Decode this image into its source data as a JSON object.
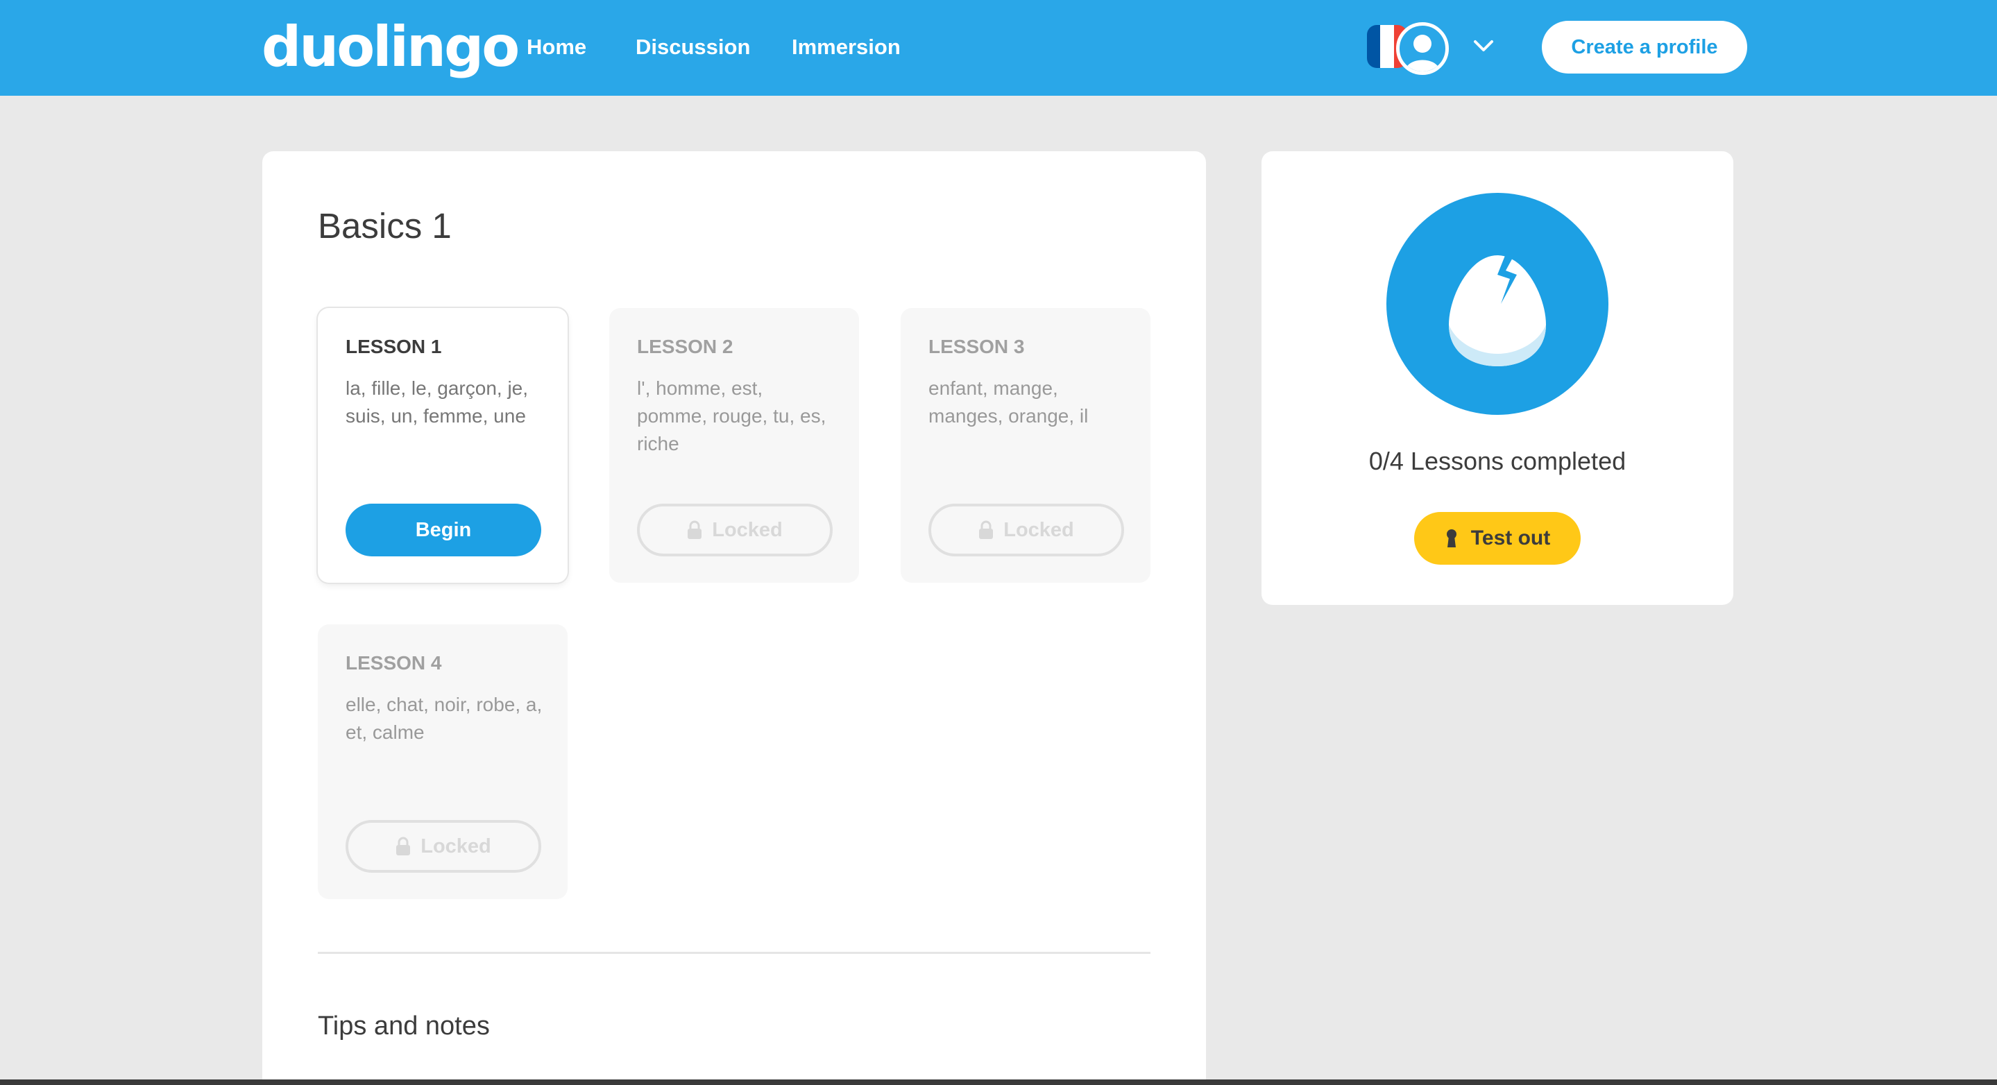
{
  "header": {
    "logo": "duolingo",
    "nav": [
      {
        "label": "Home"
      },
      {
        "label": "Discussion"
      },
      {
        "label": "Immersion"
      }
    ],
    "flag_colors": [
      "#0055a4",
      "#ffffff",
      "#ef4135"
    ],
    "create_profile_label": "Create a profile"
  },
  "skill": {
    "title": "Basics 1",
    "lessons": [
      {
        "title": "LESSON 1",
        "words": "la, fille, le, garçon, je, suis, un, femme, une",
        "button": "Begin",
        "state": "active"
      },
      {
        "title": "LESSON 2",
        "words": "l', homme, est, pomme, rouge, tu, es, riche",
        "button": "Locked",
        "state": "locked"
      },
      {
        "title": "LESSON 3",
        "words": "enfant, mange, manges, orange, il",
        "button": "Locked",
        "state": "locked"
      },
      {
        "title": "LESSON 4",
        "words": "elle, chat, noir, robe, a, et, calme",
        "button": "Locked",
        "state": "locked"
      }
    ],
    "tips_title": "Tips and notes"
  },
  "progress": {
    "text": "0/4 Lessons completed",
    "test_out_label": "Test out"
  },
  "colors": {
    "brand_blue": "#2aa7e8",
    "button_blue": "#1da0e4",
    "test_out_yellow": "#ffc817"
  }
}
